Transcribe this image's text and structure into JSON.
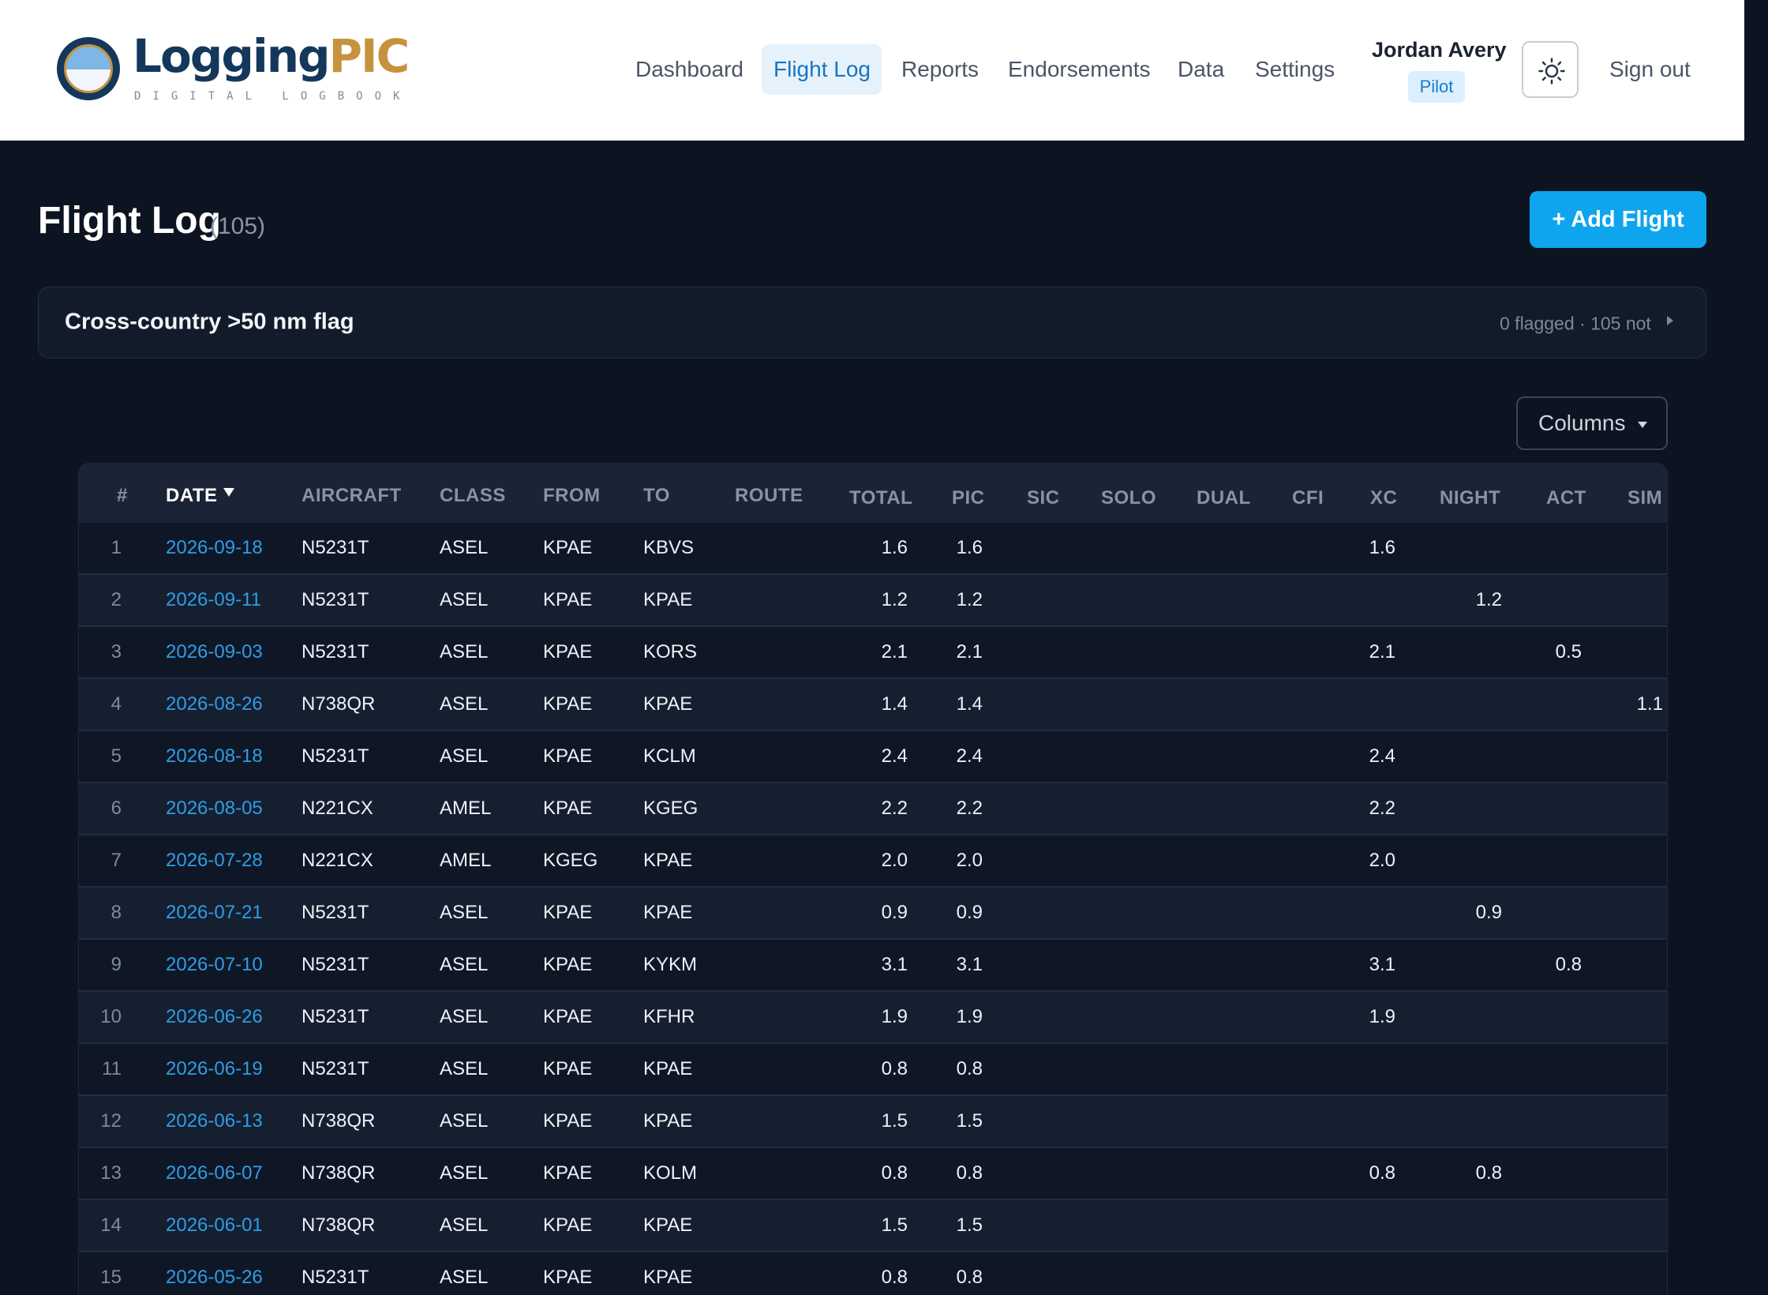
{
  "brand": {
    "name_a": "Logging",
    "name_b": "PIC",
    "tagline": "DIGITAL LOGBOOK"
  },
  "nav": {
    "items": [
      "Dashboard",
      "Flight Log",
      "Reports",
      "Endorsements",
      "Data",
      "Settings"
    ],
    "active": "Flight Log"
  },
  "user": {
    "name": "Jordan Avery",
    "role": "Pilot",
    "theme_icon": "sun-icon",
    "signout_label": "Sign out"
  },
  "page": {
    "title": "Flight Log",
    "count": "(105)",
    "add_label": "+ Add Flight"
  },
  "flag_panel": {
    "title": "Cross-country >50 nm flag",
    "summary": "0 flagged · 105 not"
  },
  "columns_button": {
    "label": "Columns"
  },
  "table": {
    "headers": [
      "#",
      "DATE",
      "AIRCRAFT",
      "CLASS",
      "FROM",
      "TO",
      "ROUTE",
      "TOTAL",
      "PIC",
      "SIC",
      "SOLO",
      "DUAL",
      "CFI",
      "XC",
      "NIGHT",
      "ACT",
      "SIM"
    ],
    "sort_column": "DATE",
    "rows": [
      {
        "n": "1",
        "date": "2026-09-18",
        "aircraft": "N5231T",
        "class": "ASEL",
        "from": "KPAE",
        "to": "KBVS",
        "total": "1.6",
        "pic": "1.6",
        "xc": "1.6",
        "night": "",
        "act": "",
        "sim": ""
      },
      {
        "n": "2",
        "date": "2026-09-11",
        "aircraft": "N5231T",
        "class": "ASEL",
        "from": "KPAE",
        "to": "KPAE",
        "total": "1.2",
        "pic": "1.2",
        "xc": "",
        "night": "1.2",
        "act": "",
        "sim": ""
      },
      {
        "n": "3",
        "date": "2026-09-03",
        "aircraft": "N5231T",
        "class": "ASEL",
        "from": "KPAE",
        "to": "KORS",
        "total": "2.1",
        "pic": "2.1",
        "xc": "2.1",
        "night": "",
        "act": "0.5",
        "sim": ""
      },
      {
        "n": "4",
        "date": "2026-08-26",
        "aircraft": "N738QR",
        "class": "ASEL",
        "from": "KPAE",
        "to": "KPAE",
        "total": "1.4",
        "pic": "1.4",
        "xc": "",
        "night": "",
        "act": "",
        "sim": "1.1"
      },
      {
        "n": "5",
        "date": "2026-08-18",
        "aircraft": "N5231T",
        "class": "ASEL",
        "from": "KPAE",
        "to": "KCLM",
        "total": "2.4",
        "pic": "2.4",
        "xc": "2.4",
        "night": "",
        "act": "",
        "sim": ""
      },
      {
        "n": "6",
        "date": "2026-08-05",
        "aircraft": "N221CX",
        "class": "AMEL",
        "from": "KPAE",
        "to": "KGEG",
        "total": "2.2",
        "pic": "2.2",
        "xc": "2.2",
        "night": "",
        "act": "",
        "sim": ""
      },
      {
        "n": "7",
        "date": "2026-07-28",
        "aircraft": "N221CX",
        "class": "AMEL",
        "from": "KGEG",
        "to": "KPAE",
        "total": "2.0",
        "pic": "2.0",
        "xc": "2.0",
        "night": "",
        "act": "",
        "sim": ""
      },
      {
        "n": "8",
        "date": "2026-07-21",
        "aircraft": "N5231T",
        "class": "ASEL",
        "from": "KPAE",
        "to": "KPAE",
        "total": "0.9",
        "pic": "0.9",
        "xc": "",
        "night": "0.9",
        "act": "",
        "sim": ""
      },
      {
        "n": "9",
        "date": "2026-07-10",
        "aircraft": "N5231T",
        "class": "ASEL",
        "from": "KPAE",
        "to": "KYKM",
        "total": "3.1",
        "pic": "3.1",
        "xc": "3.1",
        "night": "",
        "act": "0.8",
        "sim": ""
      },
      {
        "n": "10",
        "date": "2026-06-26",
        "aircraft": "N5231T",
        "class": "ASEL",
        "from": "KPAE",
        "to": "KFHR",
        "total": "1.9",
        "pic": "1.9",
        "xc": "1.9",
        "night": "",
        "act": "",
        "sim": ""
      },
      {
        "n": "11",
        "date": "2026-06-19",
        "aircraft": "N5231T",
        "class": "ASEL",
        "from": "KPAE",
        "to": "KPAE",
        "total": "0.8",
        "pic": "0.8",
        "xc": "",
        "night": "",
        "act": "",
        "sim": ""
      },
      {
        "n": "12",
        "date": "2026-06-13",
        "aircraft": "N738QR",
        "class": "ASEL",
        "from": "KPAE",
        "to": "KPAE",
        "total": "1.5",
        "pic": "1.5",
        "xc": "",
        "night": "",
        "act": "",
        "sim": ""
      },
      {
        "n": "13",
        "date": "2026-06-07",
        "aircraft": "N738QR",
        "class": "ASEL",
        "from": "KPAE",
        "to": "KOLM",
        "total": "0.8",
        "pic": "0.8",
        "xc": "0.8",
        "night": "0.8",
        "act": "",
        "sim": ""
      },
      {
        "n": "14",
        "date": "2026-06-01",
        "aircraft": "N738QR",
        "class": "ASEL",
        "from": "KPAE",
        "to": "KPAE",
        "total": "1.5",
        "pic": "1.5",
        "xc": "",
        "night": "",
        "act": "",
        "sim": ""
      },
      {
        "n": "15",
        "date": "2026-05-26",
        "aircraft": "N5231T",
        "class": "ASEL",
        "from": "KPAE",
        "to": "KPAE",
        "total": "0.8",
        "pic": "0.8",
        "xc": "",
        "night": "",
        "act": "",
        "sim": ""
      }
    ]
  },
  "colors": {
    "accent": "#0ea5ee",
    "date_link": "#2e9de6",
    "brand_navy": "#14375c",
    "brand_gold": "#c7923e",
    "background": "#0c1421"
  }
}
